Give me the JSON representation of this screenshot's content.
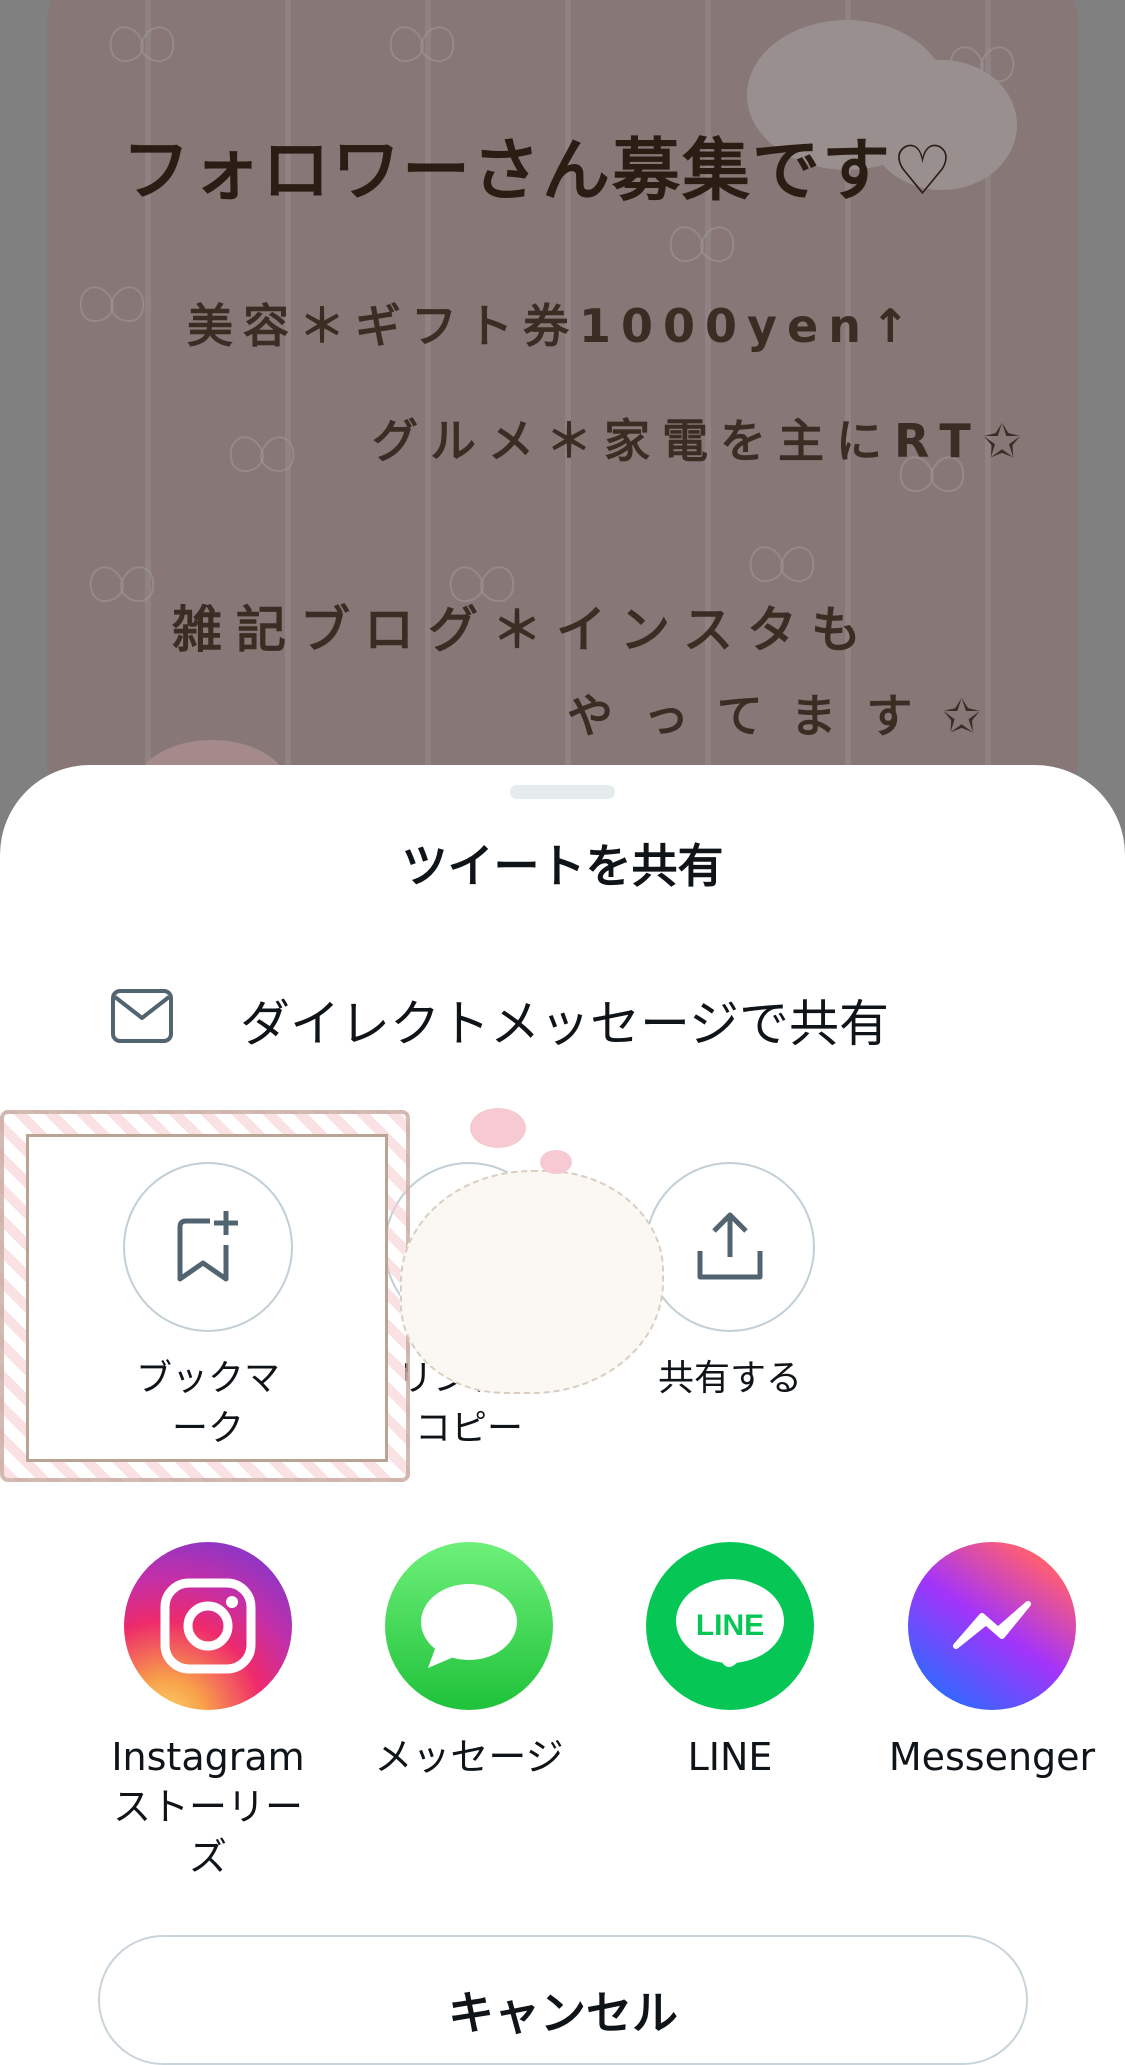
{
  "background_tweet": {
    "line1": "フォロワーさん募集です♡",
    "line2": "美容＊ギフト券1000yen↑",
    "line3": "グルメ＊家電を主にRT✩",
    "line4": "雑記ブログ＊インスタも",
    "line5": "やってます✩"
  },
  "sheet": {
    "title": "ツイートを共有",
    "dm_label": "ダイレクトメッセージで共有",
    "actions": [
      {
        "label": "ブックマーク",
        "icon": "bookmark-add-icon"
      },
      {
        "label": "リンクをコピー",
        "icon": "link-icon"
      },
      {
        "label": "共有する",
        "icon": "share-upload-icon"
      }
    ],
    "apps": [
      {
        "label": "Instagram ストーリーズ",
        "icon": "instagram-icon"
      },
      {
        "label": "メッセージ",
        "icon": "messages-icon"
      },
      {
        "label": "LINE",
        "icon": "line-icon",
        "icon_text": "LINE"
      },
      {
        "label": "Messenger",
        "icon": "messenger-icon"
      }
    ],
    "cancel_label": "キャンセル"
  },
  "colors": {
    "text": "#0f1419",
    "icon_stroke": "#536471",
    "circle_border": "#c3cfd6",
    "line_green": "#06c755",
    "messages_green": "#34c759"
  }
}
